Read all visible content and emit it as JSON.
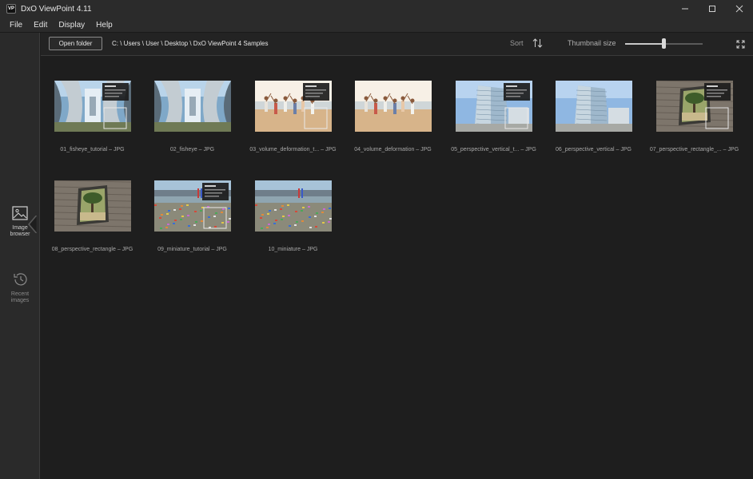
{
  "window": {
    "title": "DxO ViewPoint 4.11",
    "logo_text": "VP"
  },
  "menu": [
    "File",
    "Edit",
    "Display",
    "Help"
  ],
  "sidebar": {
    "items": [
      {
        "label_line1": "Image",
        "label_line2": "browser",
        "icon": "image-icon",
        "active": true
      },
      {
        "label_line1": "Recent",
        "label_line2": "images",
        "icon": "history-icon",
        "active": false
      }
    ]
  },
  "toolbar": {
    "open_folder_label": "Open folder",
    "path": "C: \\ Users \\ User \\ Desktop \\ DxO ViewPoint 4 Samples",
    "sort_label": "Sort",
    "thumbnail_size_label": "Thumbnail size",
    "thumbnail_size_value": 0.5
  },
  "images": [
    {
      "caption": "01_fisheye_tutorial – JPG",
      "kind": "fisheye",
      "tutorial": true
    },
    {
      "caption": "02_fisheye – JPG",
      "kind": "fisheye",
      "tutorial": false
    },
    {
      "caption": "03_volume_deformation_t... – JPG",
      "kind": "beach",
      "tutorial": true
    },
    {
      "caption": "04_volume_deformation – JPG",
      "kind": "beach",
      "tutorial": false
    },
    {
      "caption": "05_perspective_vertical_t... – JPG",
      "kind": "building",
      "tutorial": true
    },
    {
      "caption": "06_perspective_vertical – JPG",
      "kind": "building",
      "tutorial": false
    },
    {
      "caption": "07_perspective_rectangle_... – JPG",
      "kind": "wall",
      "tutorial": true
    },
    {
      "caption": "08_perspective_rectangle – JPG",
      "kind": "wall",
      "tutorial": false
    },
    {
      "caption": "09_miniature_tutorial – JPG",
      "kind": "miniature",
      "tutorial": true
    },
    {
      "caption": "10_miniature – JPG",
      "kind": "miniature",
      "tutorial": false
    }
  ]
}
